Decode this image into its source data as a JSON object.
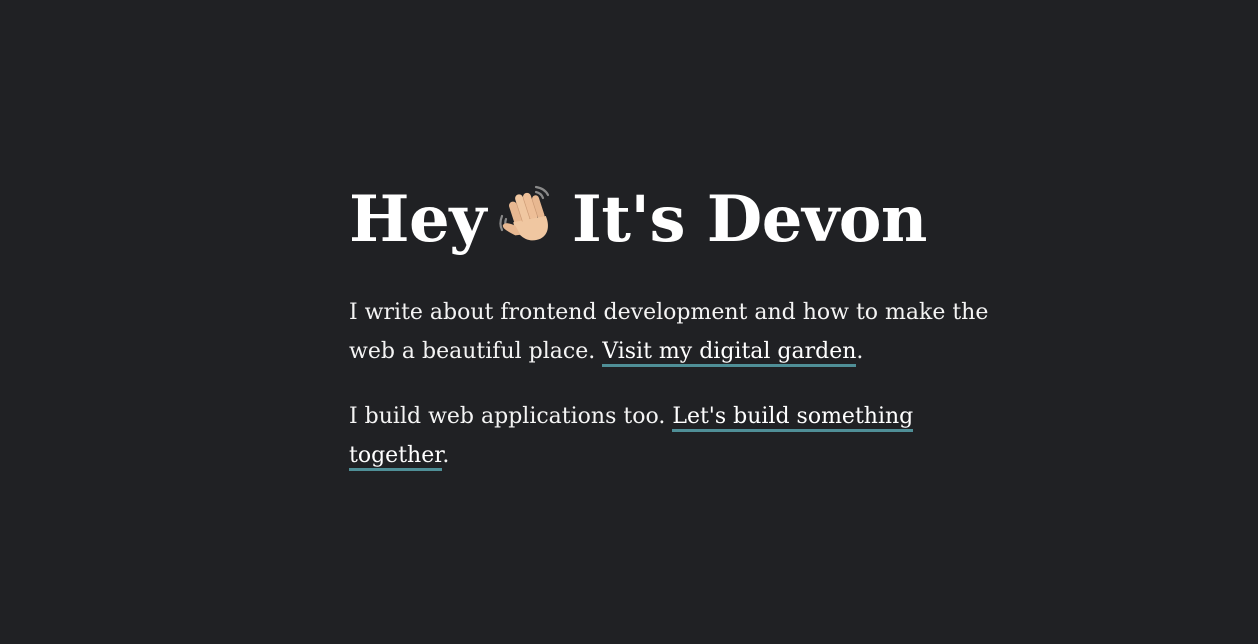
{
  "hero": {
    "greeting": "Hey",
    "wave_icon": "waving-hand-icon",
    "name": "It's Devon"
  },
  "intro": {
    "text": "I write about frontend development and how to make the web a beautiful place.",
    "link_label": "Visit my digital garden",
    "suffix": "."
  },
  "work": {
    "text": "I build web applications too.",
    "link_label": "Let's build something together",
    "suffix": "."
  },
  "colors": {
    "background": "#202124",
    "text": "#ffffff",
    "link_underline": "#4f8f97"
  }
}
